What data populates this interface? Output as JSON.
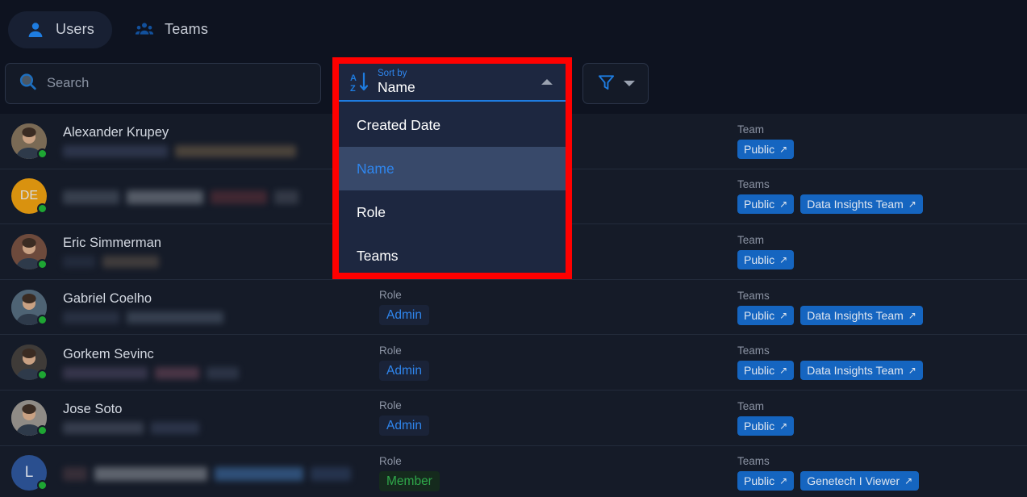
{
  "tabs": [
    {
      "label": "Users",
      "icon": "user-icon",
      "active": true
    },
    {
      "label": "Teams",
      "icon": "users-group-icon",
      "active": false
    }
  ],
  "search": {
    "placeholder": "Search",
    "value": "",
    "icon": "search-icon"
  },
  "sort": {
    "caption": "Sort by",
    "value": "Name",
    "icon": "sort-alpha-down-icon",
    "caret": "chevron-up-icon",
    "expanded": true,
    "options": [
      {
        "label": "Created Date",
        "selected": false
      },
      {
        "label": "Name",
        "selected": true
      },
      {
        "label": "Role",
        "selected": false
      },
      {
        "label": "Teams",
        "selected": false
      }
    ]
  },
  "filter": {
    "icon": "filter-icon",
    "caret": "chevron-down-icon"
  },
  "annotation": {
    "color": "#ff0000",
    "shape": "rectangle"
  },
  "colors": {
    "accent": "#2f86ee",
    "team_badge": "#1565c0",
    "admin": "#2f86ee",
    "member": "#2fa84a",
    "online": "#1ea633",
    "page_bg": "#0e1320",
    "row_bg": "#151b28",
    "dropdown_bg": "#1d2740",
    "dropdown_selected": "#38496a"
  },
  "rows": [
    {
      "name": "Alexander Krupey",
      "name_hidden": false,
      "email_redacted": true,
      "avatar": {
        "type": "photo",
        "tone": "#7a6a55",
        "initials": ""
      },
      "online": true,
      "role": null,
      "role_caption": null,
      "team_caption": "Team",
      "teams": [
        "Public"
      ]
    },
    {
      "name": "",
      "name_hidden": true,
      "email_redacted": true,
      "avatar": {
        "type": "initials",
        "tone": "#d9920f",
        "initials": "DE"
      },
      "online": true,
      "role": null,
      "role_caption": null,
      "team_caption": "Teams",
      "teams": [
        "Public",
        "Data Insights Team"
      ]
    },
    {
      "name": "Eric Simmerman",
      "name_hidden": false,
      "email_redacted": true,
      "avatar": {
        "type": "photo",
        "tone": "#6d4a3c",
        "initials": ""
      },
      "online": true,
      "role": null,
      "role_caption": null,
      "team_caption": "Team",
      "teams": [
        "Public"
      ]
    },
    {
      "name": "Gabriel Coelho",
      "name_hidden": false,
      "email_redacted": true,
      "avatar": {
        "type": "photo",
        "tone": "#4e6374",
        "initials": ""
      },
      "online": true,
      "role": "Admin",
      "role_caption": "Role",
      "team_caption": "Teams",
      "teams": [
        "Public",
        "Data Insights Team"
      ]
    },
    {
      "name": "Gorkem Sevinc",
      "name_hidden": false,
      "email_redacted": true,
      "avatar": {
        "type": "photo",
        "tone": "#3f3b38",
        "initials": ""
      },
      "online": true,
      "role": "Admin",
      "role_caption": "Role",
      "team_caption": "Teams",
      "teams": [
        "Public",
        "Data Insights Team"
      ]
    },
    {
      "name": "Jose Soto",
      "name_hidden": false,
      "email_redacted": true,
      "avatar": {
        "type": "photo",
        "tone": "#8f8b86",
        "initials": ""
      },
      "online": true,
      "role": "Admin",
      "role_caption": "Role",
      "team_caption": "Team",
      "teams": [
        "Public"
      ]
    },
    {
      "name": "",
      "name_hidden": true,
      "email_redacted": true,
      "avatar": {
        "type": "initials",
        "tone": "#2a4f8f",
        "initials": "L"
      },
      "online": true,
      "role": "Member",
      "role_caption": "Role",
      "team_caption": "Teams",
      "teams": [
        "Public",
        "Genetech I Viewer"
      ]
    }
  ]
}
